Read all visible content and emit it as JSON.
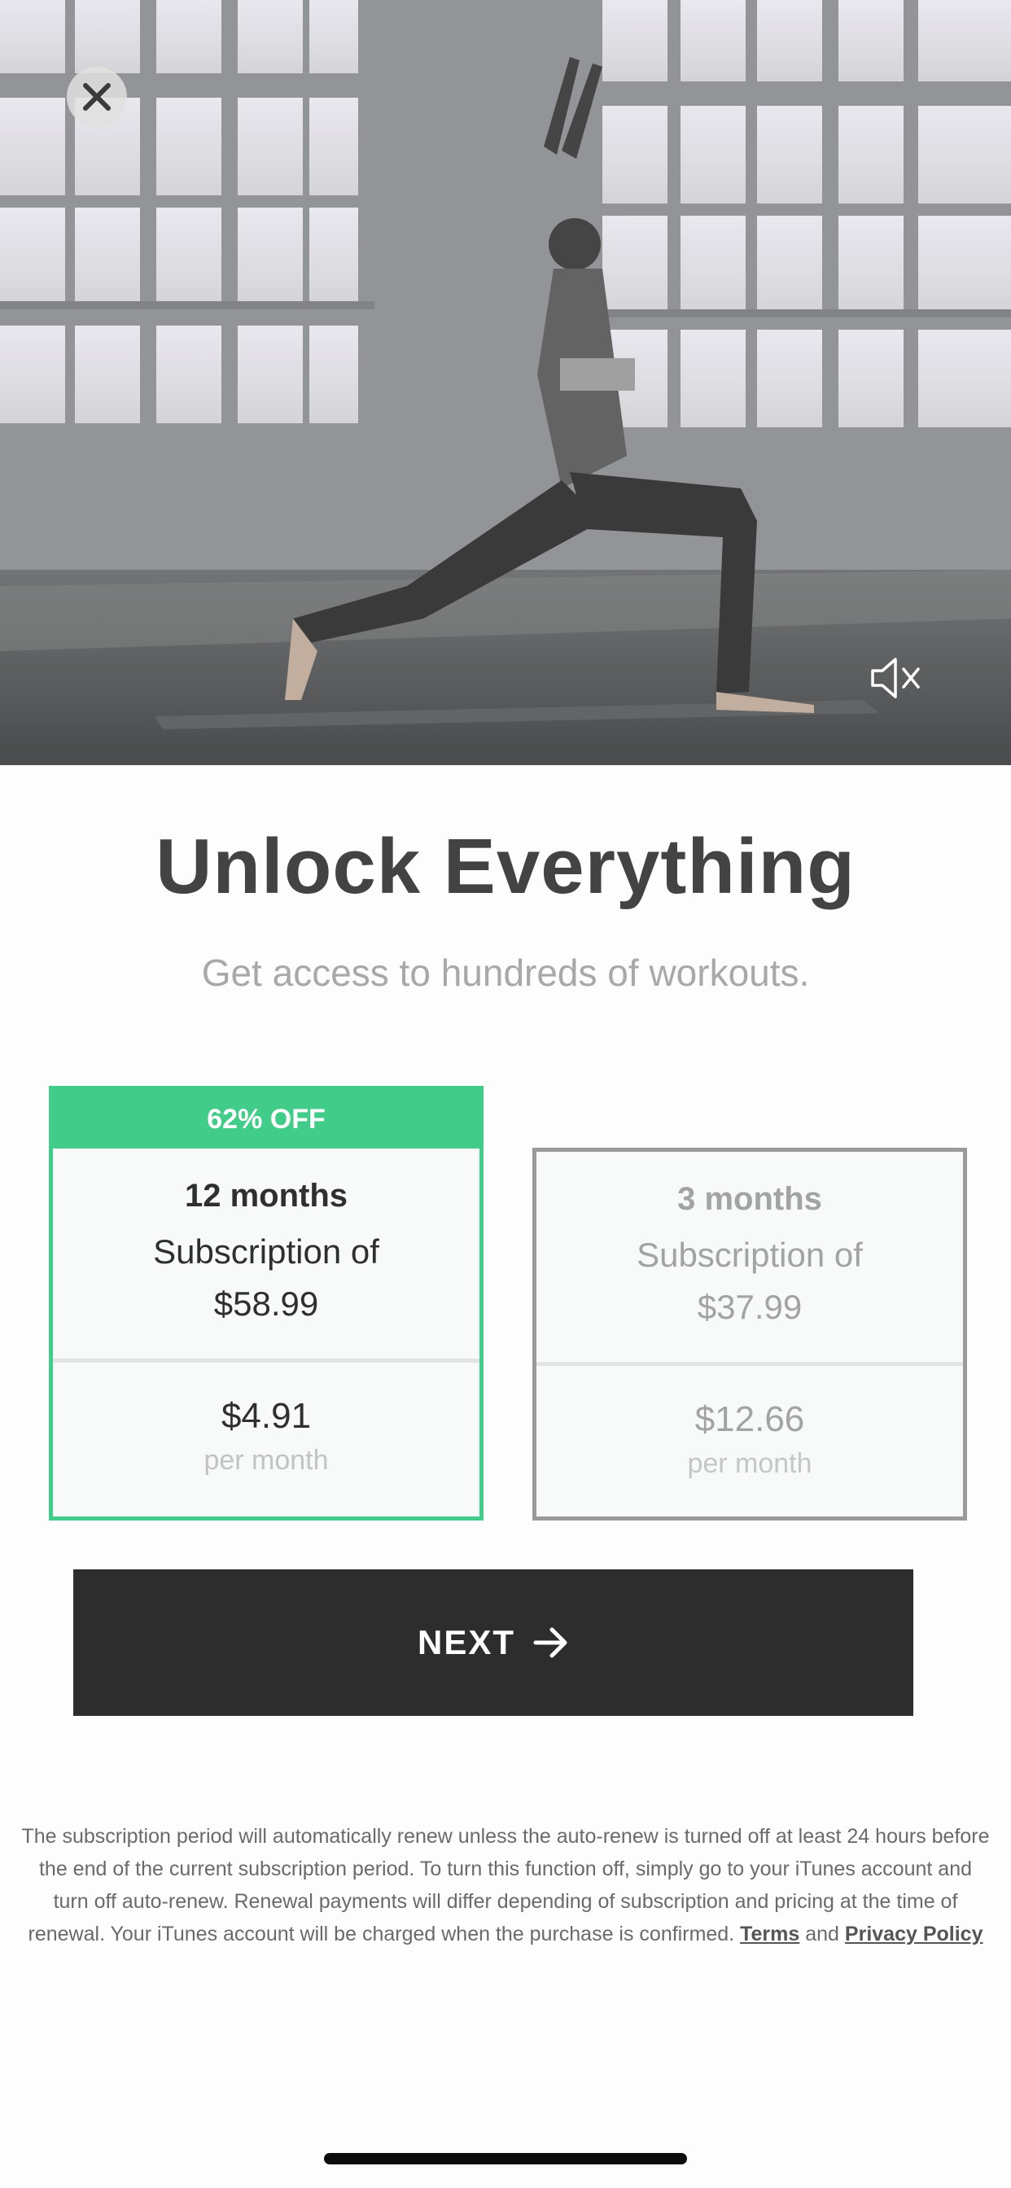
{
  "hero": {
    "close_icon": "close-icon",
    "mute_icon": "speaker-muted-icon"
  },
  "headline": {
    "title": "Unlock Everything",
    "subtitle": "Get access to hundreds of workouts."
  },
  "plans": [
    {
      "badge": "62% OFF",
      "duration": "12 months",
      "subscription_label": "Subscription of",
      "subscription_price": "$58.99",
      "monthly_price": "$4.91",
      "per_month_label": "per month",
      "selected": true
    },
    {
      "duration": "3 months",
      "subscription_label": "Subscription of",
      "subscription_price": "$37.99",
      "monthly_price": "$12.66",
      "per_month_label": "per month",
      "selected": false
    }
  ],
  "next_button": {
    "label": "NEXT",
    "icon": "arrow-right-icon"
  },
  "legal": {
    "text": "The subscription period will automatically renew unless the auto-renew is turned off at least 24 hours before the end of the current subscription period. To turn this function off, simply go to your iTunes account and turn off auto-renew. Renewal payments will differ depending of subscription and pricing at the time of renewal. Your iTunes account will be charged when the purchase is confirmed.",
    "terms_link": "Terms",
    "and_text": "and",
    "privacy_link": "Privacy Policy"
  },
  "colors": {
    "accent": "#41cc89",
    "button_bg": "#2d2d2d",
    "unselected_border": "#9a9a9a"
  }
}
